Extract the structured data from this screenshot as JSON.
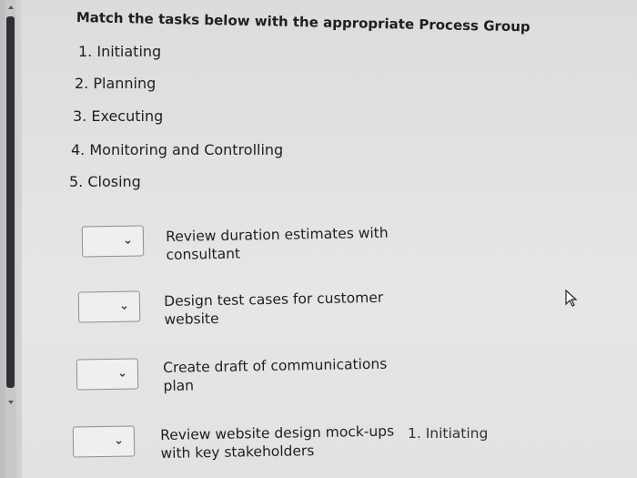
{
  "question": {
    "instruction": "Match the tasks below with the appropriate Process Group",
    "process_groups": [
      "1. Initiating",
      "2. Planning",
      "3. Executing",
      "4. Monitoring and Controlling",
      "5. Closing"
    ]
  },
  "matches": [
    {
      "task": "Review duration estimates with consultant",
      "selected": ""
    },
    {
      "task": "Design test cases for customer website",
      "selected": ""
    },
    {
      "task": "Create draft of communications plan",
      "selected": ""
    },
    {
      "task": "Review website design mock-ups with key stakeholders",
      "selected": ""
    }
  ],
  "answer_option": "1.  Initiating",
  "icons": {
    "dropdown": "chevron-down-icon",
    "cursor": "mouse-pointer-icon"
  }
}
